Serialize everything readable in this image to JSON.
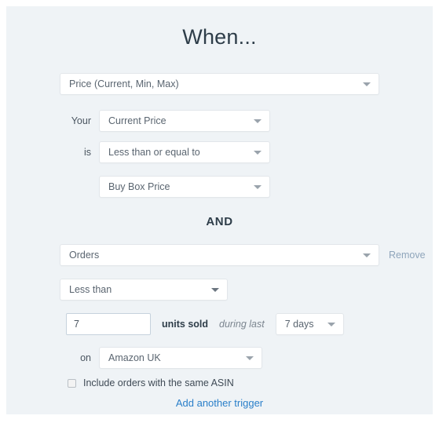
{
  "panel": {
    "title": "When...",
    "and_label": "AND"
  },
  "trigger_price": {
    "type_select": {
      "value": "Price (Current, Min, Max)",
      "caret": "chevron-down-icon"
    },
    "your_label": "Your",
    "metric_select": {
      "value": "Current Price",
      "caret": "chevron-down-icon"
    },
    "is_label": "is",
    "comparator_select": {
      "value": "Less than or equal to",
      "caret": "chevron-down-icon"
    },
    "target_select": {
      "value": "Buy Box Price",
      "caret": "chevron-down-icon"
    }
  },
  "trigger_orders": {
    "type_select": {
      "value": "Orders",
      "caret": "chevron-down-icon"
    },
    "remove_label": "Remove",
    "comparator_select": {
      "value": "Less than",
      "caret": "chevron-down-icon"
    },
    "quantity_value": "7",
    "units_label": "units sold",
    "during_label": "during last",
    "period_select": {
      "value": "7 days",
      "caret": "chevron-down-icon"
    },
    "on_label": "on",
    "marketplace_select": {
      "value": "Amazon UK",
      "caret": "chevron-down-icon"
    },
    "same_asin_label": "Include orders with the same ASIN"
  },
  "footer": {
    "add_trigger_label": "Add another trigger"
  },
  "colors": {
    "panel_bg": "#eff3f6",
    "link_blue": "#2a7fc9",
    "remove_blue": "#8fa5bb",
    "title_dark": "#2e3d49"
  }
}
